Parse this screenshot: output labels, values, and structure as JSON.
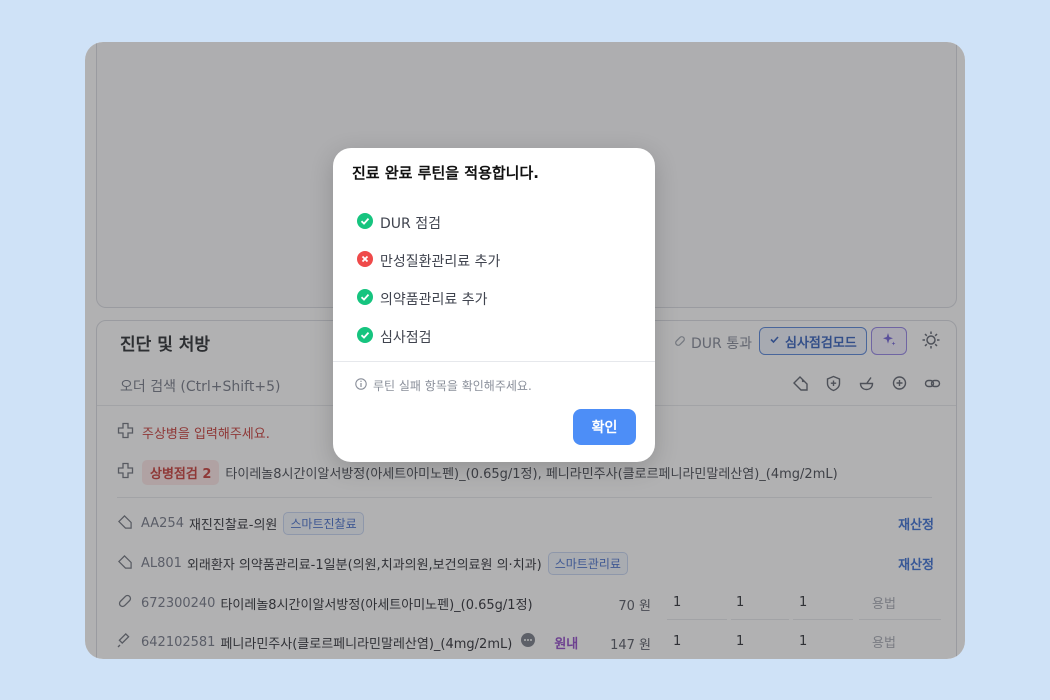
{
  "header": {
    "title": "진단 및 처방",
    "dur_pass": "DUR 통과",
    "review_mode": "심사점검모드",
    "search_placeholder": "오더 검색 (Ctrl+Shift+5)"
  },
  "diagnosis": {
    "main_prompt": "주상병을 입력해주세요.",
    "sub_badge": "상병점검 2",
    "sub_text": "타이레놀8시간이알서방정(아세트아미노펜)_(0.65g/1정), 페니라민주사(클로르페니라민말레산염)_(4mg/2mL)"
  },
  "orders": [
    {
      "code": "AA254",
      "name": "재진진찰료-의원",
      "tag": "스마트진찰료",
      "action": "재산정"
    },
    {
      "code": "AL801",
      "name": "외래환자 의약품관리료-1일분(의원,치과의원,보건의료원 의·치과)",
      "tag": "스마트관리료",
      "action": "재산정"
    }
  ],
  "drugs": [
    {
      "code": "672300240",
      "name": "타이레놀8시간이알서방정(아세트아미노펜)_(0.65g/1정)",
      "price": "70 원",
      "q1": "1",
      "q2": "1",
      "q3": "1",
      "usage": "용법"
    },
    {
      "code": "642102581",
      "name": "페니라민주사(클로르페니라민말레산염)_(4mg/2mL)",
      "place": "원내",
      "price": "147 원",
      "q1": "1",
      "q2": "1",
      "q3": "1",
      "usage": "용법"
    }
  ],
  "dialog": {
    "title": "진료 완료 루틴을 적용합니다.",
    "steps": [
      {
        "label": "DUR 점검",
        "status": "success"
      },
      {
        "label": "만성질환관리료 추가",
        "status": "fail"
      },
      {
        "label": "의약품관리료 추가",
        "status": "success"
      },
      {
        "label": "심사점검",
        "status": "success"
      }
    ],
    "notice": "루틴 실패 항목을 확인해주세요.",
    "confirm": "확인"
  },
  "colors": {
    "success": "#16c47f",
    "fail": "#ef4a4a",
    "primary": "#4d8ef7",
    "background": "#cfe2f7"
  }
}
